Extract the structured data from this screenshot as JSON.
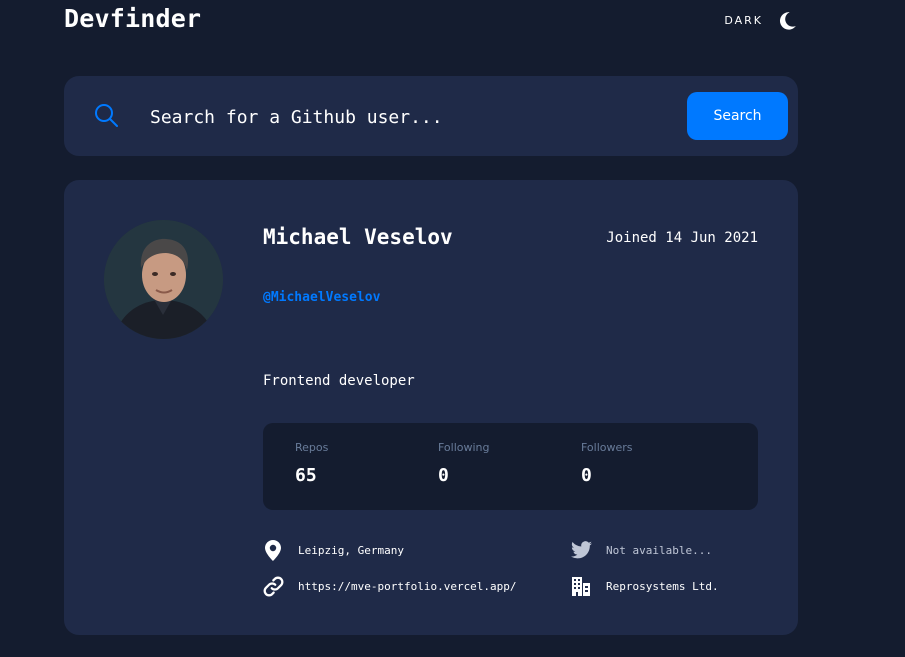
{
  "header": {
    "logo": "Devfinder",
    "theme_label": "DARK",
    "theme_icon": "moon-icon"
  },
  "search": {
    "placeholder": "Search for a Github user...",
    "button_label": "Search"
  },
  "user": {
    "name": "Michael Veselov",
    "joined": "Joined 14 Jun 2021",
    "login": "@MichaelVeselov",
    "bio": "Frontend developer",
    "stats": {
      "repos_label": "Repos",
      "repos": "65",
      "following_label": "Following",
      "following": "0",
      "followers_label": "Followers",
      "followers": "0"
    },
    "location": "Leipzig, Germany",
    "twitter": "Not available...",
    "blog": "https://mve-portfolio.vercel.app/",
    "company": "Reprosystems Ltd."
  },
  "colors": {
    "background": "#141c2f",
    "card": "#1f2a48",
    "accent": "#0079ff",
    "muted": "#697c9a"
  }
}
